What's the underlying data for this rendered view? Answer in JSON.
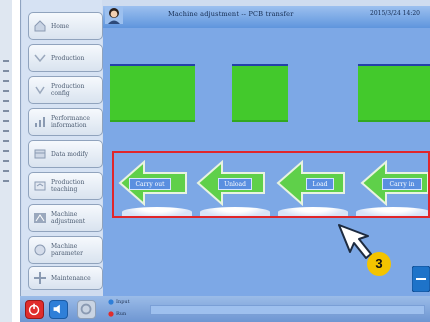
{
  "header": {
    "title": "Machine adjustment -- PCB transfer",
    "datetime": "2015/3/24 14:20"
  },
  "sidebar": {
    "items": [
      {
        "label": "Home",
        "icon": "home-icon"
      },
      {
        "label": "Production",
        "icon": "production-icon"
      },
      {
        "label": "Production\nconfig",
        "icon": "config-icon"
      },
      {
        "label": "Performance\ninformation",
        "icon": "chart-icon"
      },
      {
        "label": "Data modify",
        "icon": "data-icon"
      },
      {
        "label": "Production\nteaching",
        "icon": "teaching-icon"
      },
      {
        "label": "Machine\nadjustment",
        "icon": "adjust-icon"
      },
      {
        "label": "Machine\nparameter",
        "icon": "parameter-icon"
      },
      {
        "label": "Maintenance",
        "icon": "maintenance-icon"
      }
    ]
  },
  "transfer": {
    "buttons": [
      {
        "label": "Carry out"
      },
      {
        "label": "Unload"
      },
      {
        "label": "Load"
      },
      {
        "label": "Carry in"
      }
    ]
  },
  "callout": {
    "number": "3"
  },
  "footer": {
    "legend_1": "Input",
    "legend_2": "Run"
  },
  "colors": {
    "accent_red": "#e0262a",
    "conveyor_green": "#43c92c",
    "panel_blue": "#7da8e6",
    "callout_yellow": "#f4c400"
  }
}
